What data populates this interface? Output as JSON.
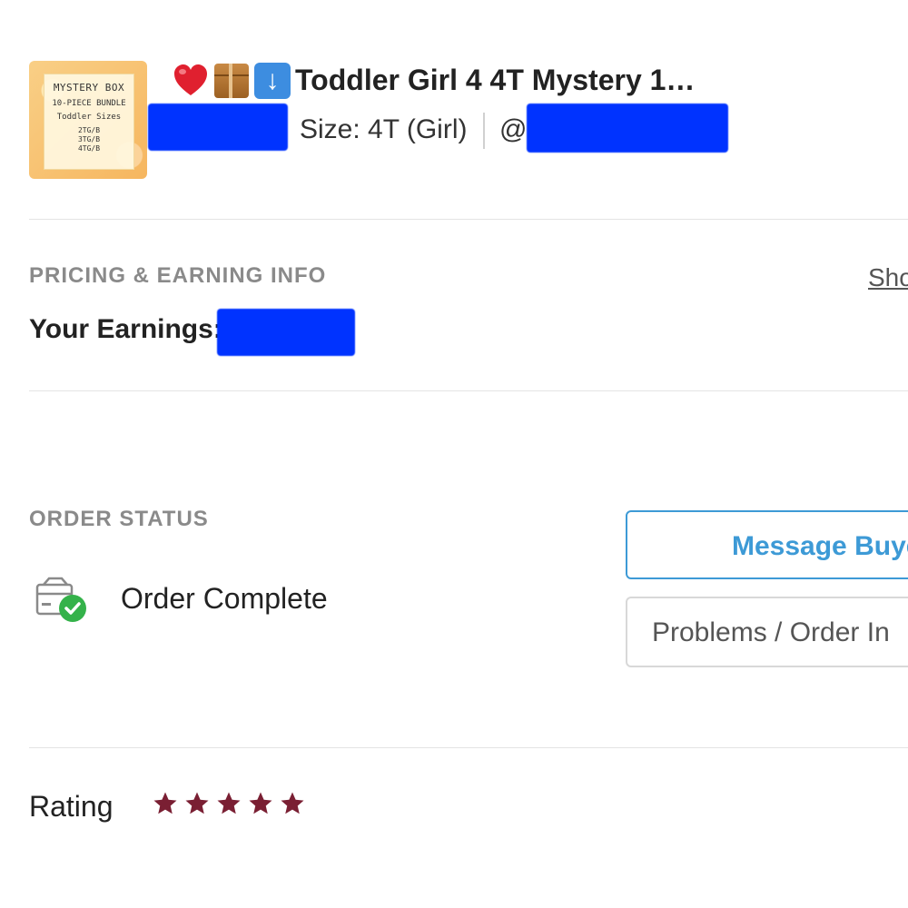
{
  "item": {
    "thumbnail": {
      "line1": "MYSTERY BOX",
      "line2": "10-PIECE BUNDLE",
      "line3": "Toddler Sizes",
      "line4": "2TG/B",
      "line5": "3TG/B",
      "line6": "4TG/B"
    },
    "emoji_icons": [
      "heart-icon",
      "package-icon",
      "down-arrow-icon"
    ],
    "title": "Toddler Girl 4 4T Mystery 1…",
    "size": "Size: 4T (Girl)",
    "seller_prefix": "@"
  },
  "pricing": {
    "section_label": "PRICING & EARNING INFO",
    "show_link": "Sho",
    "earnings_label": "Your Earnings:"
  },
  "order_status": {
    "section_label": "ORDER STATUS",
    "status_text": "Order Complete",
    "status_icon": "package-check-icon",
    "message_button": "Message Buye",
    "problems_button": "Problems / Order In"
  },
  "rating": {
    "label": "Rating",
    "stars": 5,
    "max_stars": 5,
    "star_color": "#7a1f33"
  },
  "colors": {
    "accent": "#3d9ad6",
    "redaction": "#0033ff",
    "status_green": "#34b24a"
  }
}
